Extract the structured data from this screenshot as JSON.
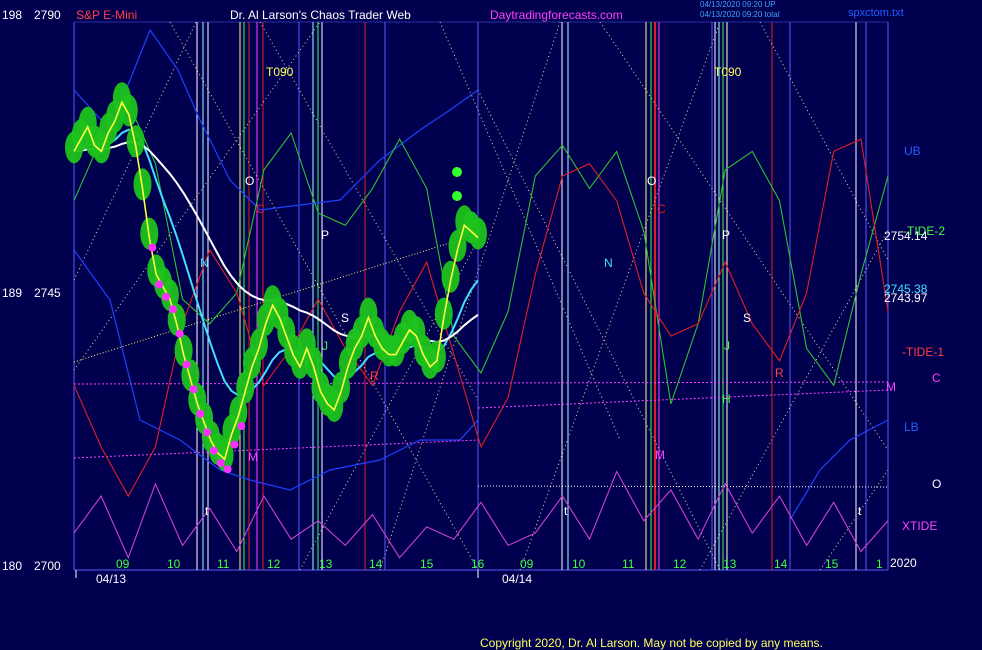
{
  "header": {
    "left_axis_top_label": "198",
    "price_top_label": "2790",
    "instrument": "S&P E-Mini",
    "title": "Dr. Al Larson's Chaos Trader Web",
    "site": "Daytradingforecasts.com",
    "stamp_line1": "04/13/2020 09:20 UP",
    "stamp_line2": "04/13/2020 09:20 total",
    "file": "spxctom.txt"
  },
  "left_axis": {
    "mid_num": "189",
    "mid_price": "2745",
    "bottom_num": "180",
    "bottom_price": "2700"
  },
  "dates": {
    "left": "04/13",
    "right": "04/14"
  },
  "copyright": "Copyright 2020, Dr. Al Larson. May not be copied by any means.",
  "right_labels": {
    "ub": "UB",
    "tide2": "-TIDE-2",
    "price1": "2754.14",
    "price2": "2745.38",
    "price3": "2743.97",
    "tide1": "-TIDE-1",
    "c": "C",
    "m": "M",
    "lb": "LB",
    "o": "O",
    "xtide": "XTIDE",
    "year": "2020"
  },
  "chart_data": {
    "type": "line",
    "title": "Dr. Al Larson's Chaos Trader Web",
    "ylim": [
      2700,
      2790
    ],
    "y_ticks": [
      2700,
      2745,
      2790
    ],
    "x_hour_ticks": [
      "09",
      "10",
      "11",
      "12",
      "13",
      "14",
      "15",
      "16",
      "09",
      "10",
      "11",
      "12",
      "13",
      "14",
      "15",
      "1"
    ],
    "price_bars": [
      2768,
      2770,
      2772,
      2769,
      2768,
      2771,
      2773,
      2776,
      2774,
      2769,
      2762,
      2754,
      2748,
      2746,
      2744,
      2740,
      2735,
      2731,
      2727,
      2724,
      2721,
      2719,
      2718,
      2722,
      2725,
      2729,
      2733,
      2736,
      2740,
      2743,
      2741,
      2738,
      2735,
      2733,
      2736,
      2733,
      2729,
      2727,
      2726,
      2729,
      2733,
      2736,
      2738,
      2741,
      2738,
      2736,
      2735,
      2735,
      2737,
      2739,
      2738,
      2735,
      2733,
      2734,
      2741,
      2747,
      2752,
      2756,
      2755,
      2754
    ],
    "series": [
      {
        "name": "TIDE-2",
        "values": [
          2760,
          2770,
          2776,
          2766,
          2744,
          2740,
          2745,
          2765,
          2771,
          2758,
          2756,
          2762,
          2770,
          2762,
          2738,
          2732,
          2742,
          2764,
          2769,
          2762,
          2768,
          2755,
          2727,
          2740,
          2765,
          2768,
          2760,
          2736,
          2730,
          2748,
          2764
        ]
      },
      {
        "name": "TIDE-1",
        "values": [
          2730,
          2720,
          2712,
          2720,
          2740,
          2752,
          2745,
          2730,
          2736,
          2744,
          2736,
          2730,
          2742,
          2750,
          2735,
          2720,
          2728,
          2748,
          2764,
          2766,
          2760,
          2745,
          2738,
          2740,
          2750,
          2740,
          2734,
          2745,
          2768,
          2770,
          2742
        ]
      },
      {
        "name": "XTIDE",
        "values": [
          2706,
          2712,
          2702,
          2714,
          2704,
          2710,
          2703,
          2712,
          2705,
          2708,
          2704,
          2709,
          2702,
          2707,
          2705,
          2711,
          2704,
          2706,
          2712,
          2705,
          2716,
          2708,
          2713,
          2705,
          2714,
          2706,
          2712,
          2704,
          2711,
          2703,
          2708
        ]
      }
    ],
    "hour_labels_left": [
      "09",
      "10",
      "11",
      "12",
      "13",
      "14",
      "15",
      "16"
    ],
    "hour_labels_right": [
      "09",
      "10",
      "11",
      "12",
      "13",
      "14",
      "15",
      "1"
    ]
  },
  "annotations": {
    "t090_left": "T090",
    "t090_right": "T090",
    "o1": "O",
    "c1": "C",
    "n1": "N",
    "p1": "P",
    "s1": "S",
    "j1": "J",
    "r1": "R",
    "m1": "M",
    "t1": "t",
    "o2": "O",
    "c2": "C",
    "n2": "N",
    "p2": "P",
    "s2": "S",
    "j2": "J",
    "h2": "H",
    "r2": "R",
    "m2": "M",
    "t2": "t",
    "t3": "t"
  },
  "colors": {
    "background": "#00004e",
    "plot_border": "#5a5aff",
    "green_band": "#1ec21e",
    "price": "#ffff40",
    "ema_cyan": "#40e0ff",
    "ema_white": "#ffffff",
    "tide_green": "#30c030",
    "tide_red": "#e02020",
    "xtide": "#d040d0",
    "magenta_dot": "#ff30ff"
  }
}
